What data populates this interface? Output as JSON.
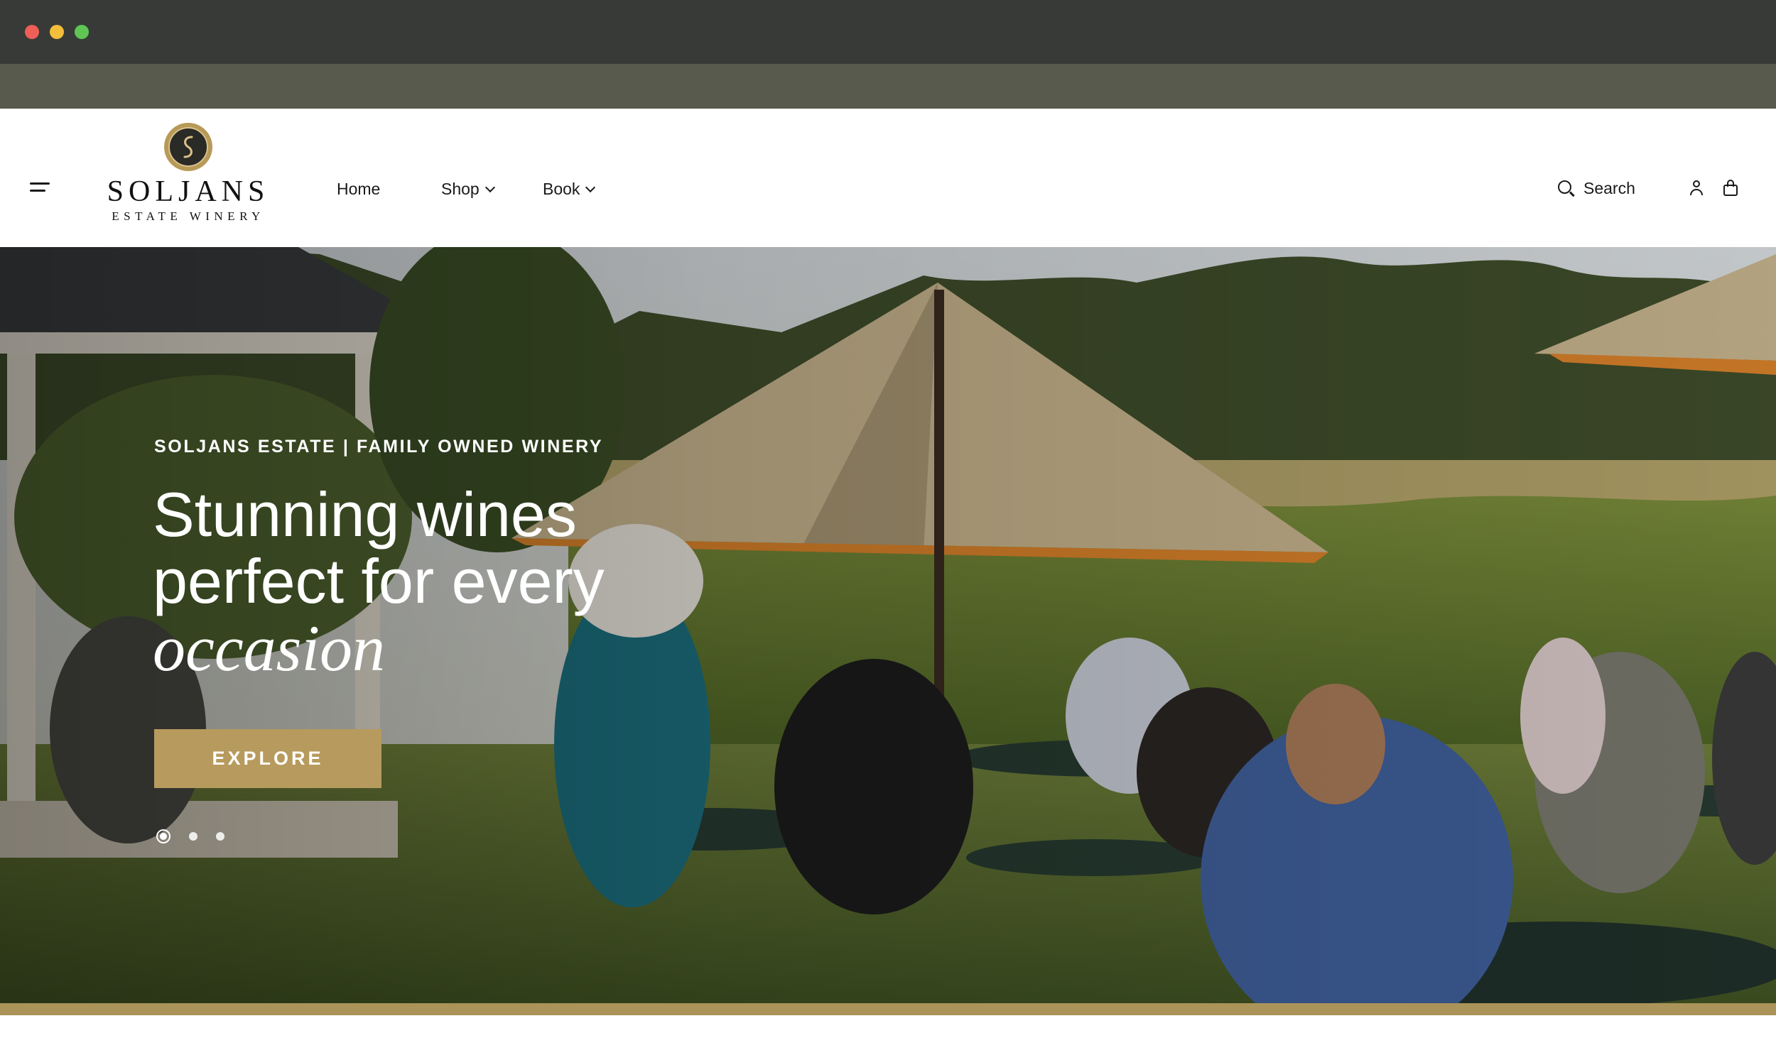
{
  "brand": {
    "name": "SOLJANS",
    "tagline": "ESTATE WINERY",
    "gold": "#b79a5d"
  },
  "nav": {
    "items": [
      {
        "label": "Home"
      },
      {
        "label": "Shop"
      },
      {
        "label": "Book"
      }
    ],
    "search_label": "Search"
  },
  "hero": {
    "eyebrow": "SOLJANS ESTATE | FAMILY OWNED WINERY",
    "headline_line1": "Stunning wines",
    "headline_line2": "perfect for every",
    "headline_line3": "occasion",
    "cta_label": "EXPLORE",
    "slide_count": 3,
    "active_slide": 1
  },
  "icons": [
    "menu-icon",
    "search-icon",
    "account-icon",
    "cart-icon",
    "chevron-down-icon"
  ]
}
